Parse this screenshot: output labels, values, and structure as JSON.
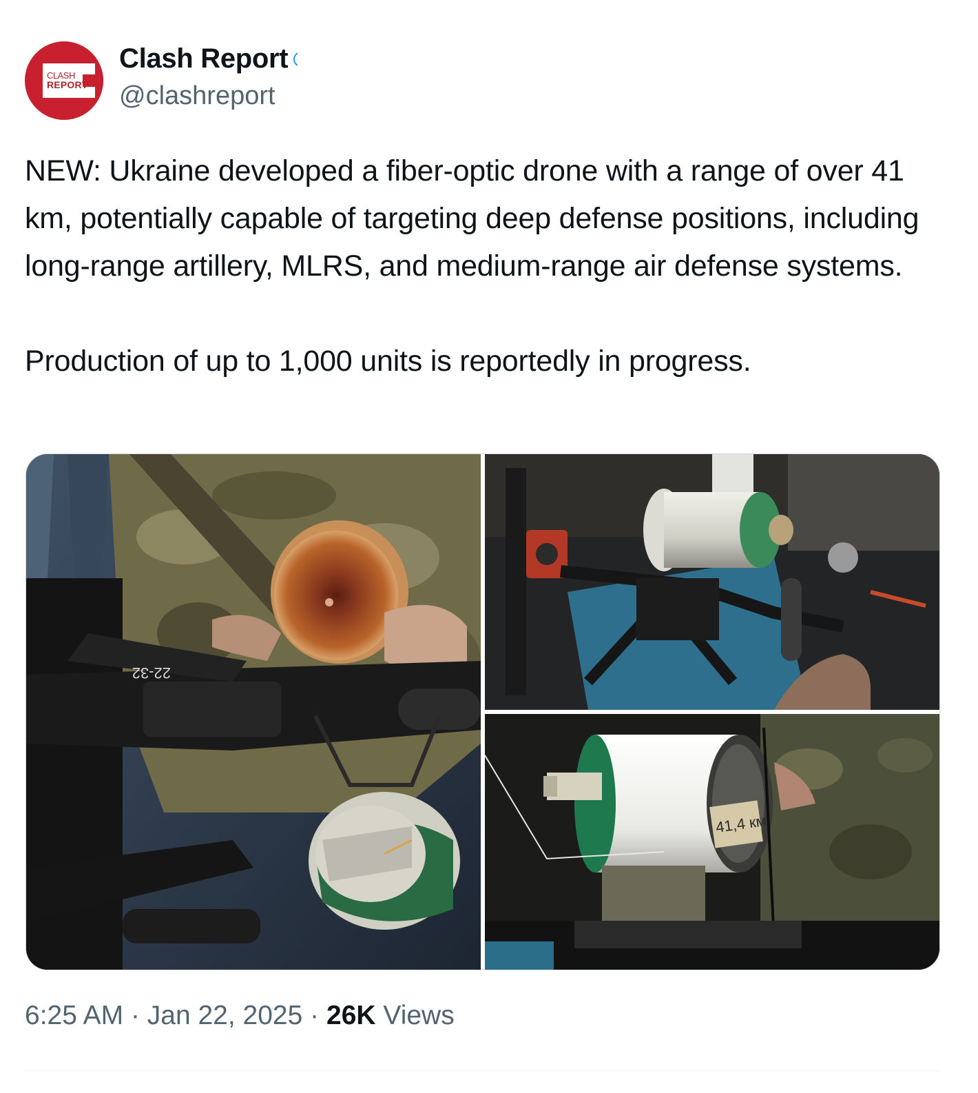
{
  "author": {
    "display_name": "Clash Report",
    "handle": "@clashreport",
    "avatar_logo_line1": "CLASH",
    "avatar_logo_line2": "REPORT",
    "brand_color": "#c8202e",
    "verified_icon": "verified-badge-icon"
  },
  "tweet": {
    "paragraph_1": "NEW: Ukraine developed a fiber-optic drone with a range of over 41 km, potentially capable of targeting deep defense positions, including long-range artillery, MLRS, and medium-range air defense systems.",
    "paragraph_2": "Production of up to 1,000 units is reportedly in progress."
  },
  "media": {
    "photo_1_marking": "22-32",
    "photo_3_label": "41,4 км"
  },
  "meta": {
    "time": "6:25 AM",
    "separator": "·",
    "date": "Jan 22, 2025",
    "views_count": "26K",
    "views_label": "Views"
  },
  "colors": {
    "text_primary": "#0f1419",
    "text_secondary": "#536471",
    "accent": "#1d9bf0",
    "border": "#cfd9de"
  }
}
